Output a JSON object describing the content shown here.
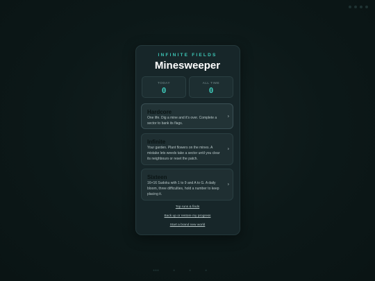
{
  "header": {
    "eyebrow": "INFINITE FIELDS",
    "title": "Minesweeper"
  },
  "stats": [
    {
      "label": "TODAY",
      "value": "0"
    },
    {
      "label": "ALL TIME",
      "value": "0"
    }
  ],
  "modes": [
    {
      "title": "Hardcore",
      "description": "One life. Dig a mine and it's over. Complete a sector to bank its flags."
    },
    {
      "title": "Infinite",
      "description": "Your garden. Plant flowers on the mines. A mistake lets weeds take a sector until you clear its neighbours or reset the patch."
    },
    {
      "title": "Sixteen",
      "description": "16×16 Sudoku with 1 to 9 and A to G. A daily bloom, three difficulties, hold a number to keep placing it."
    }
  ],
  "links": {
    "top_runs": "Top runs & finds",
    "backup": "Back up or restore my progress",
    "new_world": "Start a brand new world"
  },
  "icons": {
    "chevron": "chevron-right-icon"
  }
}
